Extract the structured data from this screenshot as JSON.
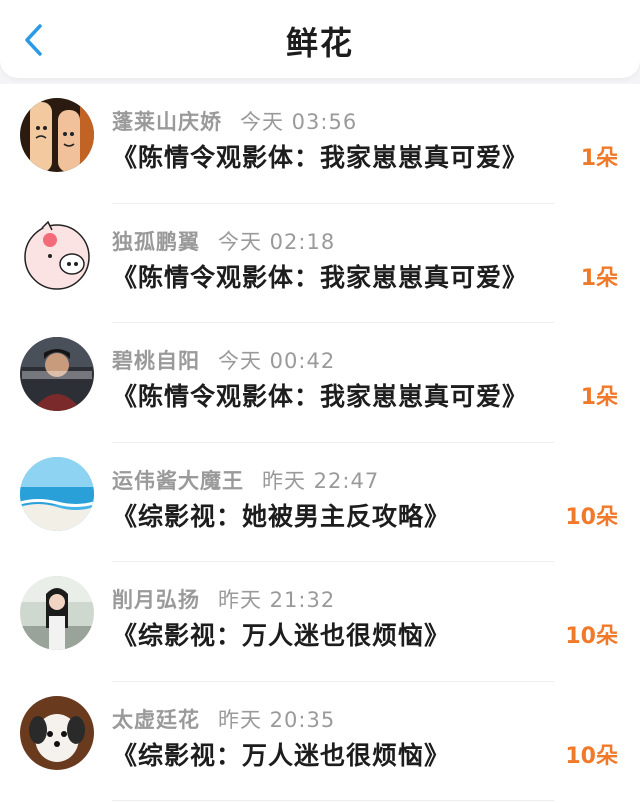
{
  "header": {
    "title": "鲜花"
  },
  "theme": {
    "accent": "#2b9be5",
    "count_color": "#f07a2a"
  },
  "items": [
    {
      "user": "蓬莱山庆娇",
      "time": "今天 03:56",
      "title": "《陈情令观影体：我家崽崽真可爱》",
      "count": "1朵",
      "avatar_icon": "fingers-faces-avatar"
    },
    {
      "user": "独孤鹏翼",
      "time": "今天 02:18",
      "title": "《陈情令观影体：我家崽崽真可爱》",
      "count": "1朵",
      "avatar_icon": "cartoon-pig-avatar"
    },
    {
      "user": "碧桃自阳",
      "time": "今天 00:42",
      "title": "《陈情令观影体：我家崽崽真可爱》",
      "count": "1朵",
      "avatar_icon": "person-photo-avatar"
    },
    {
      "user": "运伟酱大魔王",
      "time": "昨天 22:47",
      "title": "《综影视：她被男主反攻略》",
      "count": "10朵",
      "avatar_icon": "beach-avatar"
    },
    {
      "user": "削月弘扬",
      "time": "昨天 21:32",
      "title": "《综影视：万人迷也很烦恼》",
      "count": "10朵",
      "avatar_icon": "girl-photo-avatar"
    },
    {
      "user": "太虚廷花",
      "time": "昨天 20:35",
      "title": "《综影视：万人迷也很烦恼》",
      "count": "10朵",
      "avatar_icon": "puppy-avatar"
    }
  ]
}
